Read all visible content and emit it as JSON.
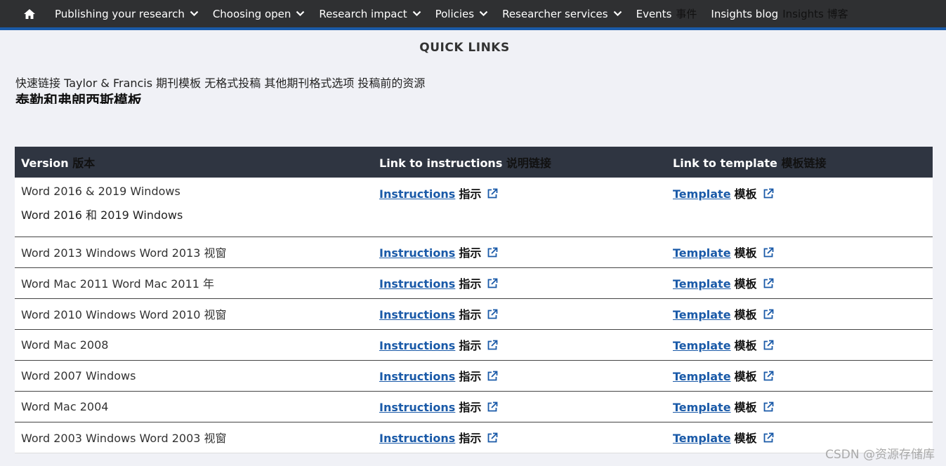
{
  "nav": {
    "home_icon": "home-icon",
    "items": [
      {
        "label": "Publishing your research",
        "zh": "",
        "has_chevron": true
      },
      {
        "label": "Choosing open",
        "zh": "",
        "has_chevron": true
      },
      {
        "label": "Research impact",
        "zh": "",
        "has_chevron": true
      },
      {
        "label": "Policies",
        "zh": "",
        "has_chevron": true
      },
      {
        "label": "Researcher services",
        "zh": "",
        "has_chevron": true
      },
      {
        "label": "Events",
        "zh": "事件",
        "has_chevron": false
      },
      {
        "label": "Insights blog",
        "zh": "Insights 博客",
        "has_chevron": false
      }
    ]
  },
  "quick_links": {
    "title": "QUICK LINKS",
    "translated_line": "快速链接 Taylor & Francis 期刊模板 无格式投稿 其他期刊格式选项 投稿前的资源",
    "overlapped_heading": "泰勒和弗朗西斯模板"
  },
  "table": {
    "headers": [
      {
        "en": "Version",
        "zh": "版本"
      },
      {
        "en": "Link to instructions",
        "zh": "说明链接"
      },
      {
        "en": "Link to template",
        "zh": "模板链接"
      }
    ],
    "link_labels": {
      "instructions": "Instructions",
      "instructions_zh": "指示",
      "template": "Template",
      "template_zh": "模板"
    },
    "rows": [
      {
        "version": "Word 2016 & 2019 Windows",
        "version_zh": "Word 2016 和 2019 Windows"
      },
      {
        "version": "Word 2013 Windows Word 2013 视窗",
        "version_zh": ""
      },
      {
        "version": "Word Mac 2011 Word Mac 2011 年",
        "version_zh": ""
      },
      {
        "version": "Word 2010 Windows Word 2010 视窗",
        "version_zh": ""
      },
      {
        "version": "Word Mac 2008",
        "version_zh": ""
      },
      {
        "version": "Word 2007 Windows",
        "version_zh": ""
      },
      {
        "version": "Word Mac 2004",
        "version_zh": ""
      },
      {
        "version": "Word 2003 Windows Word 2003 视窗",
        "version_zh": ""
      }
    ]
  },
  "watermark": "CSDN @资源存储库",
  "colors": {
    "nav_bg": "#2f3032",
    "nav_accent": "#1a5aa8",
    "link": "#1a5aa8",
    "table_header_bg": "#2f3541"
  }
}
